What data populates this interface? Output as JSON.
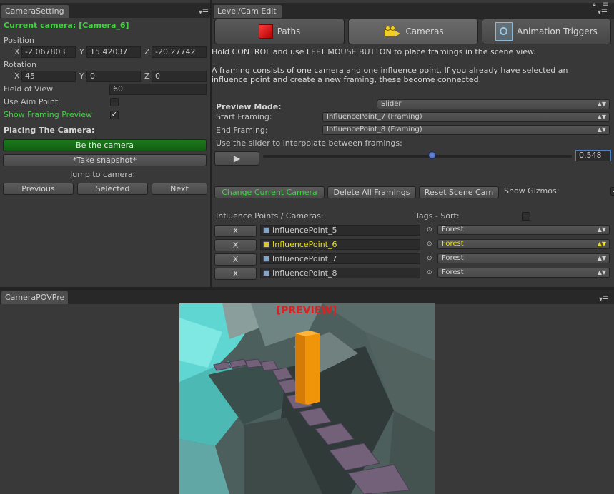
{
  "left_panel": {
    "tab_title": "CameraSetting",
    "current_camera": "Current camera: [Camera_6]",
    "position_label": "Position",
    "position": {
      "x": "-2.067803",
      "y": "15.42037",
      "z": "-20.27742"
    },
    "rotation_label": "Rotation",
    "rotation": {
      "x": "45",
      "y": "0",
      "z": "0"
    },
    "fov_label": "Field of View",
    "fov_value": "60",
    "use_aim_label": "Use Aim Point",
    "show_preview_label": "Show Framing Preview",
    "placing_label": "Placing The Camera:",
    "be_camera": "Be the camera",
    "take_snapshot": "*Take snapshot*",
    "jump_label": "Jump to camera:",
    "previous": "Previous",
    "selected": "Selected",
    "next": "Next",
    "xl": "X",
    "yl": "Y",
    "zl": "Z"
  },
  "right_panel": {
    "tab_title": "Level/Cam Edit",
    "tabs": [
      {
        "label": "Paths"
      },
      {
        "label": "Cameras"
      },
      {
        "label": "Animation Triggers"
      }
    ],
    "instruction1": "Hold CONTROL and use LEFT MOUSE BUTTON to place framings in the scene view.",
    "instruction2": "A framing consists of one camera and one influence point. If you already have selected an influence point and create a new framing, these become connected.",
    "preview_mode_label": "Preview Mode:",
    "preview_mode_value": "Slider",
    "start_framing_label": "Start Framing:",
    "start_framing_value": "InfluencePoint_7 (Framing)",
    "end_framing_label": "End Framing:",
    "end_framing_value": "InfluencePoint_8 (Framing)",
    "slider_hint": "Use the slider to interpolate between framings:",
    "slider_value": "0.548",
    "slider_fraction": 0.548,
    "change_camera": "Change Current Camera",
    "delete_all": "Delete All Framings",
    "reset_scene": "Reset Scene Cam",
    "show_gizmos": "Show Gizmos:",
    "ip_header": "Influence Points / Cameras:",
    "tags_header": "Tags - Sort:",
    "rows": [
      {
        "x": "X",
        "name": "InfluencePoint_5",
        "tag": "Forest"
      },
      {
        "x": "X",
        "name": "InfluencePoint_6",
        "tag": "Forest"
      },
      {
        "x": "X",
        "name": "InfluencePoint_7",
        "tag": "Forest"
      },
      {
        "x": "X",
        "name": "InfluencePoint_8",
        "tag": "Forest"
      }
    ]
  },
  "bottom_panel": {
    "tab_title": "CameraPOVPre",
    "preview_label": "[PREVIEW]"
  },
  "colors": {
    "green": "#3fd33f",
    "highlight": "#e8e020",
    "preview_red": "#e02020"
  }
}
